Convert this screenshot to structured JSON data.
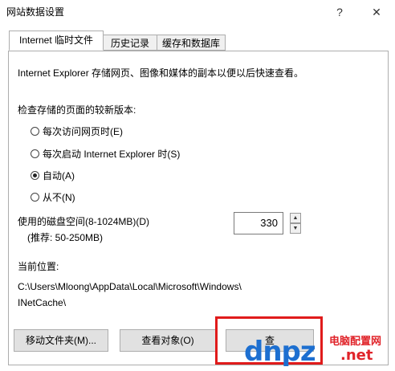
{
  "window": {
    "title": "网站数据设置",
    "help": "?",
    "close": "✕"
  },
  "tabs": [
    {
      "label": "Internet 临时文件"
    },
    {
      "label": "历史记录"
    },
    {
      "label": "缓存和数据库"
    }
  ],
  "panel": {
    "description": "Internet Explorer 存储网页、图像和媒体的副本以便以后快速查看。",
    "check_label": "检查存储的页面的较新版本:",
    "options": [
      {
        "label": "每次访问网页时(E)",
        "checked": false
      },
      {
        "label": "每次启动 Internet Explorer 时(S)",
        "checked": false
      },
      {
        "label": "自动(A)",
        "checked": true
      },
      {
        "label": "从不(N)",
        "checked": false
      }
    ],
    "disk_label": "使用的磁盘空间(8-1024MB)(D)",
    "disk_hint": "(推荐: 50-250MB)",
    "disk_value": "330",
    "location_label": "当前位置:",
    "location_path_line1": "C:\\Users\\Mloong\\AppData\\Local\\Microsoft\\Windows\\",
    "location_path_line2": "INetCache\\"
  },
  "buttons": {
    "move_folder": "移动文件夹(M)...",
    "view_objects": "查看对象(O)",
    "view_files": "查"
  },
  "watermark": {
    "cn": "电脑配置网",
    "dn": "dnpz",
    "net": ".net"
  }
}
